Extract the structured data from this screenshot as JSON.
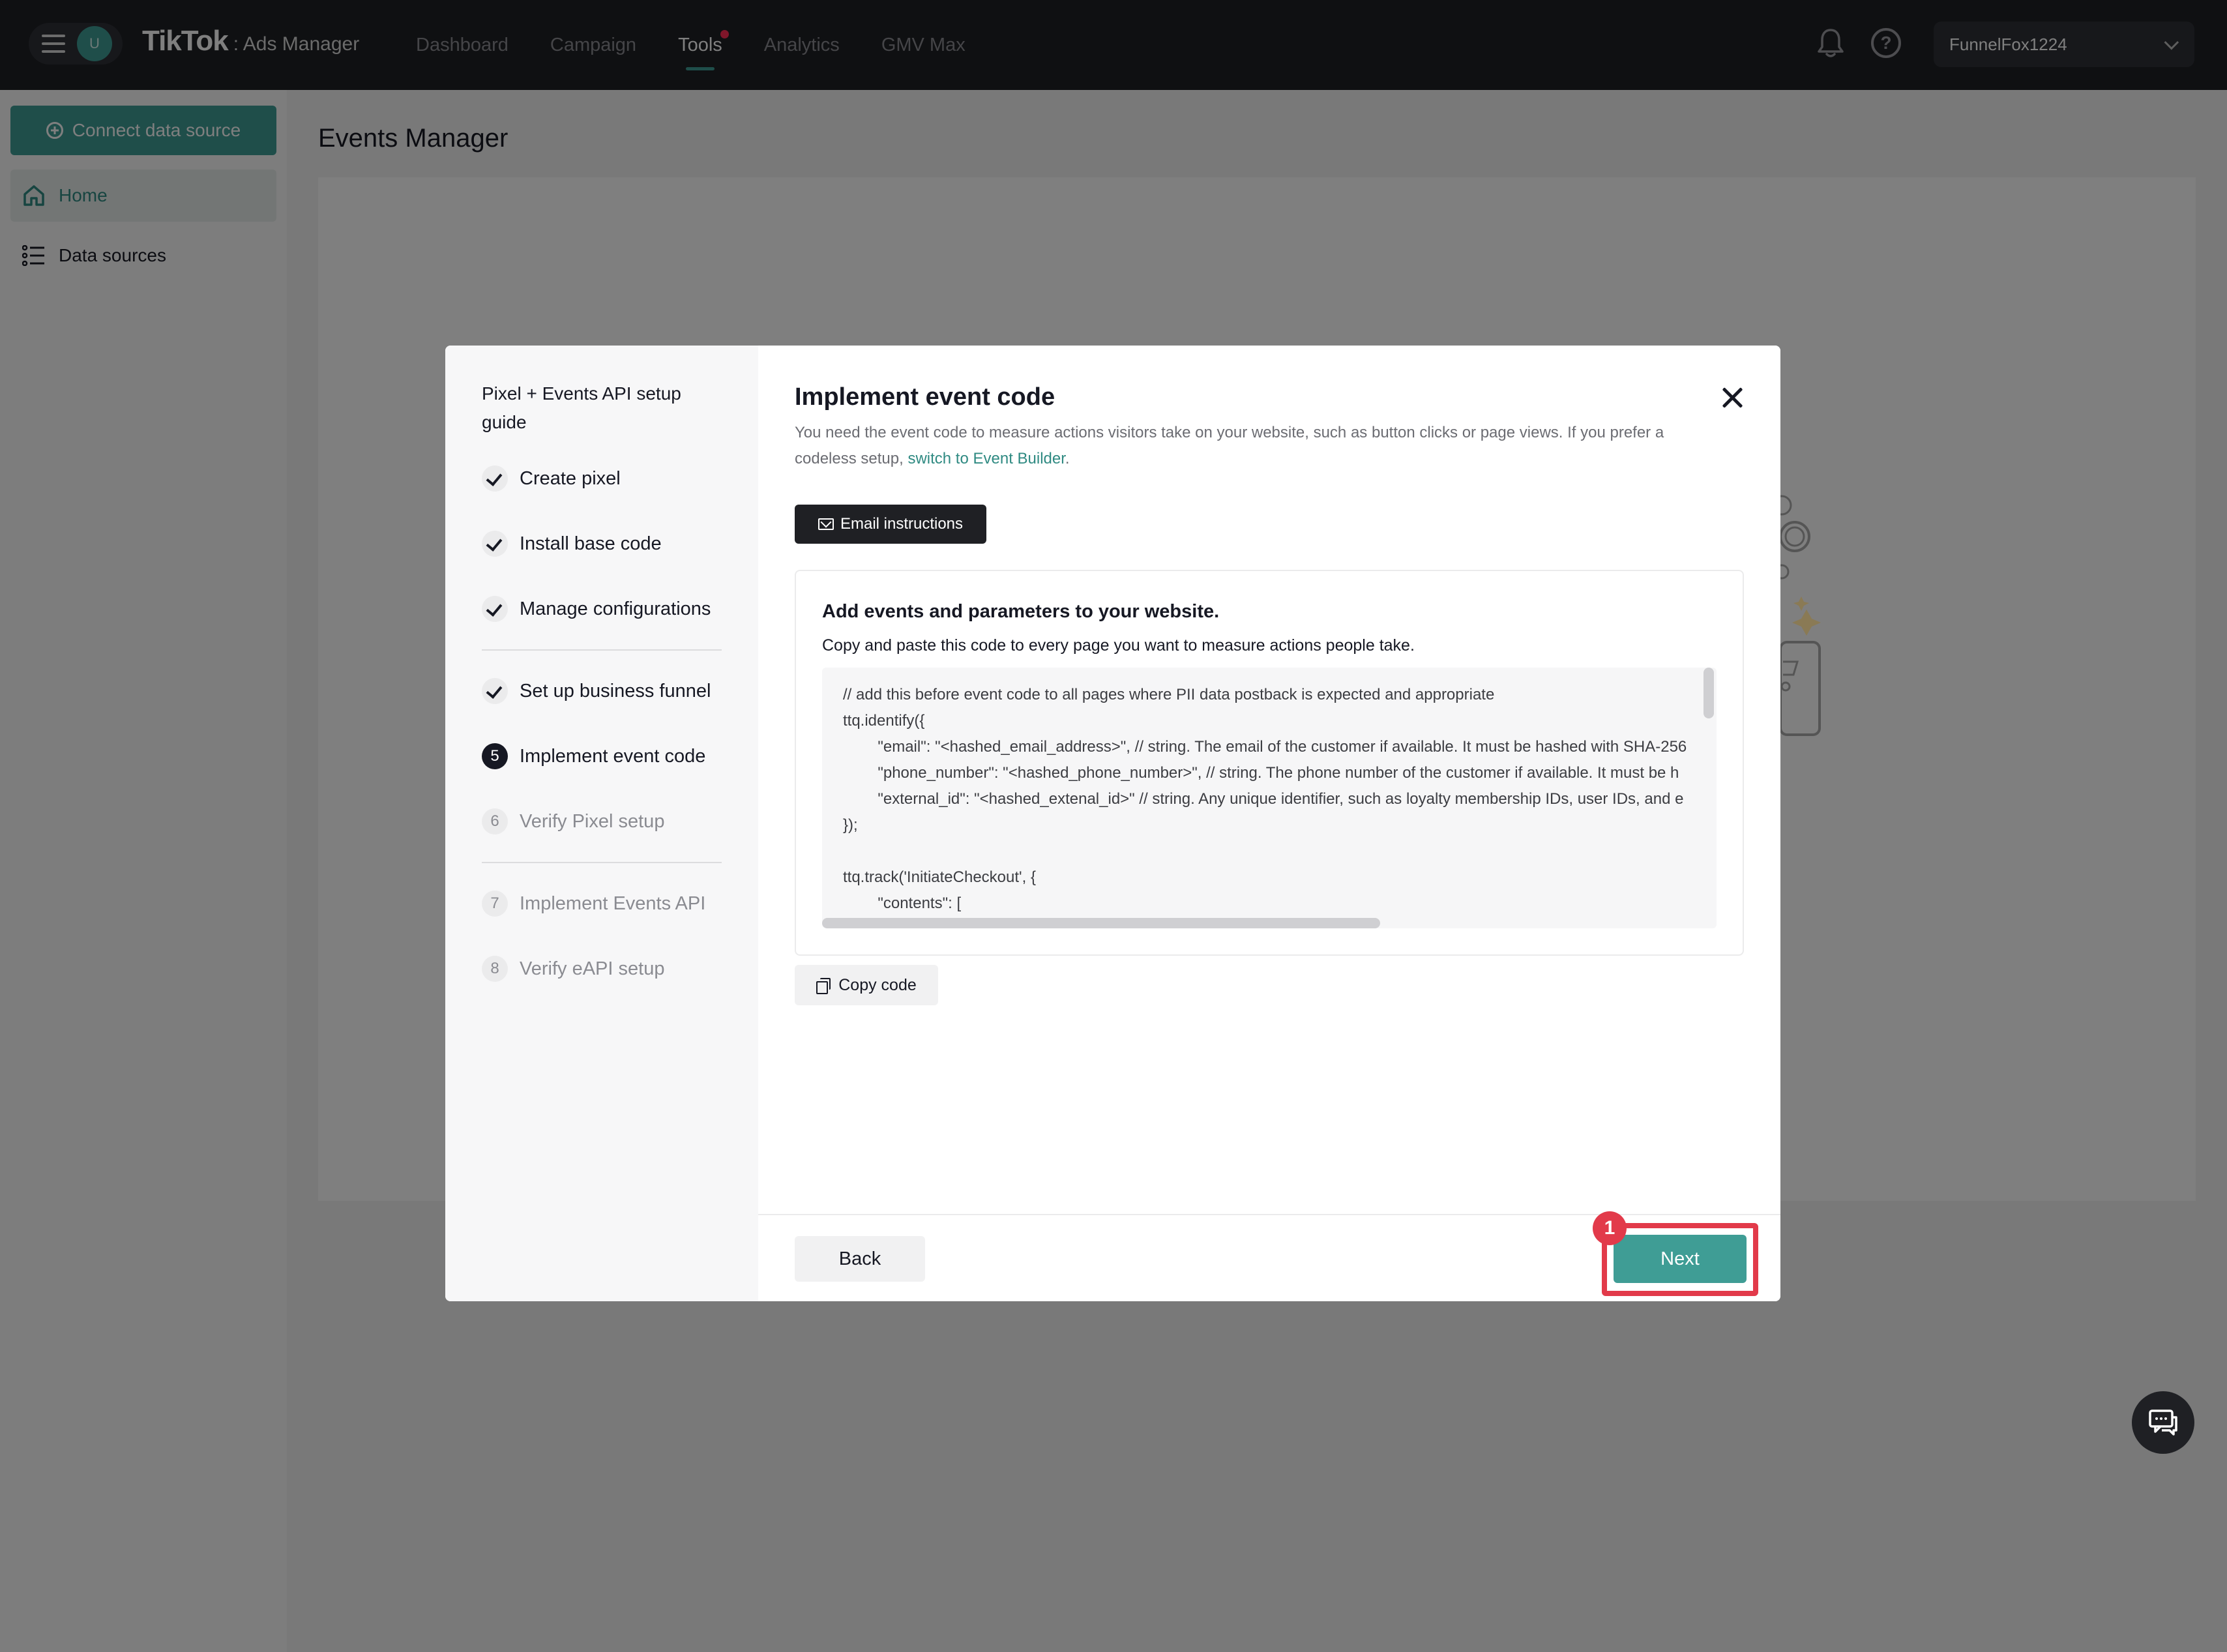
{
  "topbar": {
    "avatar_initial": "U",
    "brand_logo": "TikTok",
    "brand_sub": ": Ads Manager",
    "nav": [
      {
        "label": "Dashboard"
      },
      {
        "label": "Campaign"
      },
      {
        "label": "Tools"
      },
      {
        "label": "Analytics"
      },
      {
        "label": "GMV Max"
      }
    ],
    "active_nav": "Tools",
    "account_name": "FunnelFox1224"
  },
  "sidebar": {
    "connect_label": "Connect data source",
    "items": [
      {
        "label": "Home",
        "icon": "home-icon"
      },
      {
        "label": "Data sources",
        "icon": "list-icon"
      }
    ]
  },
  "page": {
    "title": "Events Manager"
  },
  "modal": {
    "guide_title": "Pixel + Events API setup guide",
    "steps": [
      {
        "num": "1",
        "label": "Create pixel",
        "state": "done"
      },
      {
        "num": "2",
        "label": "Install base code",
        "state": "done"
      },
      {
        "num": "3",
        "label": "Manage configurations",
        "state": "done"
      },
      {
        "num": "4",
        "label": "Set up business funnel",
        "state": "done"
      },
      {
        "num": "5",
        "label": "Implement event code",
        "state": "current"
      },
      {
        "num": "6",
        "label": "Verify Pixel setup",
        "state": "pending"
      },
      {
        "num": "7",
        "label": "Implement Events API",
        "state": "pending"
      },
      {
        "num": "8",
        "label": "Verify eAPI setup",
        "state": "pending"
      }
    ],
    "title": "Implement event code",
    "description": "You need the event code to measure actions visitors take on your website, such as button clicks or page views. If you prefer a codeless setup,",
    "description_link": "switch to Event Builder",
    "description_end": ".",
    "email_button": "Email instructions",
    "card_title": "Add events and parameters to your website.",
    "card_desc": "Copy and paste this code to every page you want to measure actions people take.",
    "code_lines": [
      "// add this before event code to all pages where PII data postback is expected and appropriate",
      "ttq.identify({",
      "        \"email\": \"<hashed_email_address>\", // string. The email of the customer if available. It must be hashed with SHA-256",
      "        \"phone_number\": \"<hashed_phone_number>\", // string. The phone number of the customer if available. It must be h",
      "        \"external_id\": \"<hashed_extenal_id>\" // string. Any unique identifier, such as loyalty membership IDs, user IDs, and e",
      "});",
      "",
      "ttq.track('InitiateCheckout', {",
      "        \"contents\": ["
    ],
    "copy_button": "Copy code",
    "back_button": "Back",
    "next_button": "Next",
    "annotation_badge": "1"
  },
  "colors": {
    "accent": "#3f9d95",
    "topbar": "#1f2024",
    "highlight": "#e23a4a"
  }
}
